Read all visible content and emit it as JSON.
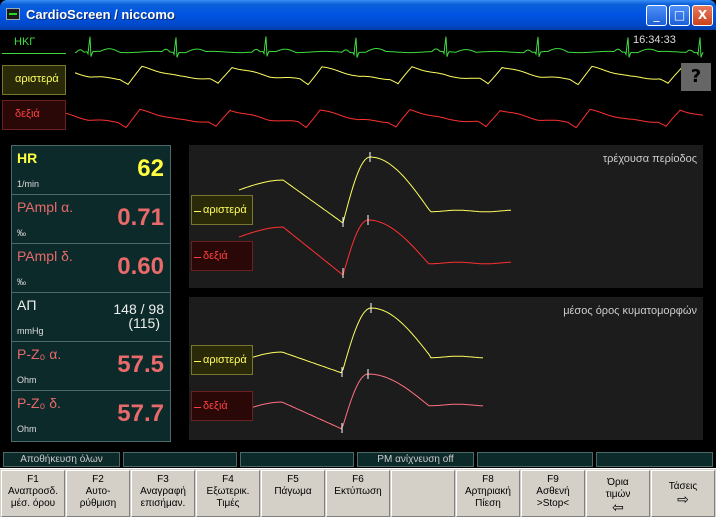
{
  "window": {
    "title": "CardioScreen / niccomo",
    "minimize": "_",
    "maximize": "□",
    "close": "X"
  },
  "monitor": {
    "clock": "16:34:33",
    "help": "?",
    "channels": [
      {
        "label": "HKΓ",
        "color": "#3ddc3d"
      },
      {
        "label": "αριστερά",
        "color": "#ffff60"
      },
      {
        "label": "δεξιά",
        "color": "#ff4040"
      }
    ]
  },
  "values": {
    "hr": {
      "name": "HR",
      "unit": "1/min",
      "value": "62"
    },
    "pampl_a": {
      "name": "PAmpl α.",
      "unit": "‰",
      "value": "0.71"
    },
    "pampl_d": {
      "name": "PAmpl δ.",
      "unit": "‰",
      "value": "0.60"
    },
    "bp": {
      "name": "ΑΠ",
      "unit": "mmHg",
      "value": "148 / 98",
      "mean": "(115)"
    },
    "pz_a": {
      "name": "P-Z₀ α.",
      "unit": "Ohm",
      "value": "57.5"
    },
    "pz_d": {
      "name": "P-Z₀ δ.",
      "unit": "Ohm",
      "value": "57.7"
    }
  },
  "panels": {
    "current": {
      "title": "τρέχουσα περίοδος",
      "left": "αριστερά",
      "right": "δεξιά"
    },
    "average": {
      "title": "μέσος όρος κυματομορφών",
      "left": "αριστερά",
      "right": "δεξιά"
    }
  },
  "status": {
    "save_all": "Αποθήκευση όλων",
    "pm_detection": "PM ανίχνευση off"
  },
  "fkeys": [
    {
      "key": "F1",
      "label": "Αναπροσδ.\nμέσ. όρου"
    },
    {
      "key": "F2",
      "label": "Αυτο-\nρύθμιση"
    },
    {
      "key": "F3",
      "label": "Αναγραφή\nεπισήμαν."
    },
    {
      "key": "F4",
      "label": "Εξωτερικ.\nΤιμές"
    },
    {
      "key": "F5",
      "label": "Πάγωμα"
    },
    {
      "key": "F6",
      "label": "Εκτύπωση"
    },
    {
      "key": "",
      "label": ""
    },
    {
      "key": "F8",
      "label": "Αρτηριακή\nΠίεση"
    },
    {
      "key": "F9",
      "label": "Ασθενή\n>Stop<"
    },
    {
      "key": "",
      "label": "Όρια\nτιμών",
      "arrow": "⇦"
    },
    {
      "key": "",
      "label": "Τάσεις",
      "arrow": "⇨"
    }
  ]
}
